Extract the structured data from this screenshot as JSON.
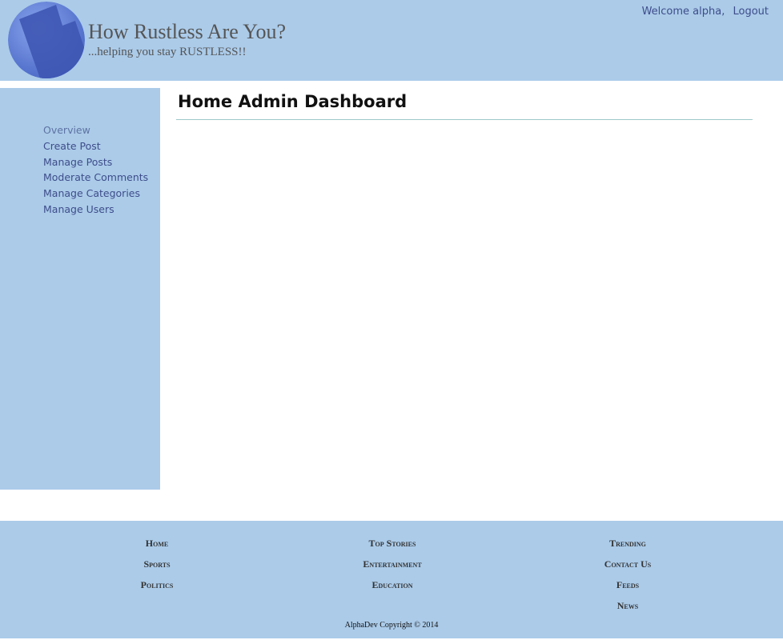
{
  "header": {
    "title": "How Rustless Are You?",
    "tagline": "...helping you stay RUSTLESS!!",
    "welcome": "Welcome alpha,",
    "logout": "Logout"
  },
  "sidebar": {
    "items": [
      {
        "label": "Overview"
      },
      {
        "label": "Create Post"
      },
      {
        "label": "Manage Posts"
      },
      {
        "label": "Moderate Comments"
      },
      {
        "label": "Manage Categories"
      },
      {
        "label": "Manage Users"
      }
    ]
  },
  "main": {
    "title": "Home Admin Dashboard"
  },
  "footer": {
    "col1": [
      "Home",
      "Sports",
      "Politics"
    ],
    "col2": [
      "Top Stories",
      "Entertainment",
      "Education"
    ],
    "col3": [
      "Trending",
      "Contact Us",
      "Feeds",
      "News"
    ],
    "copyright": "AlphaDev Copyright © 2014"
  },
  "colors": {
    "panel": "#abcbe9",
    "link": "#3e4d8a",
    "rule": "#9ec8c8"
  }
}
